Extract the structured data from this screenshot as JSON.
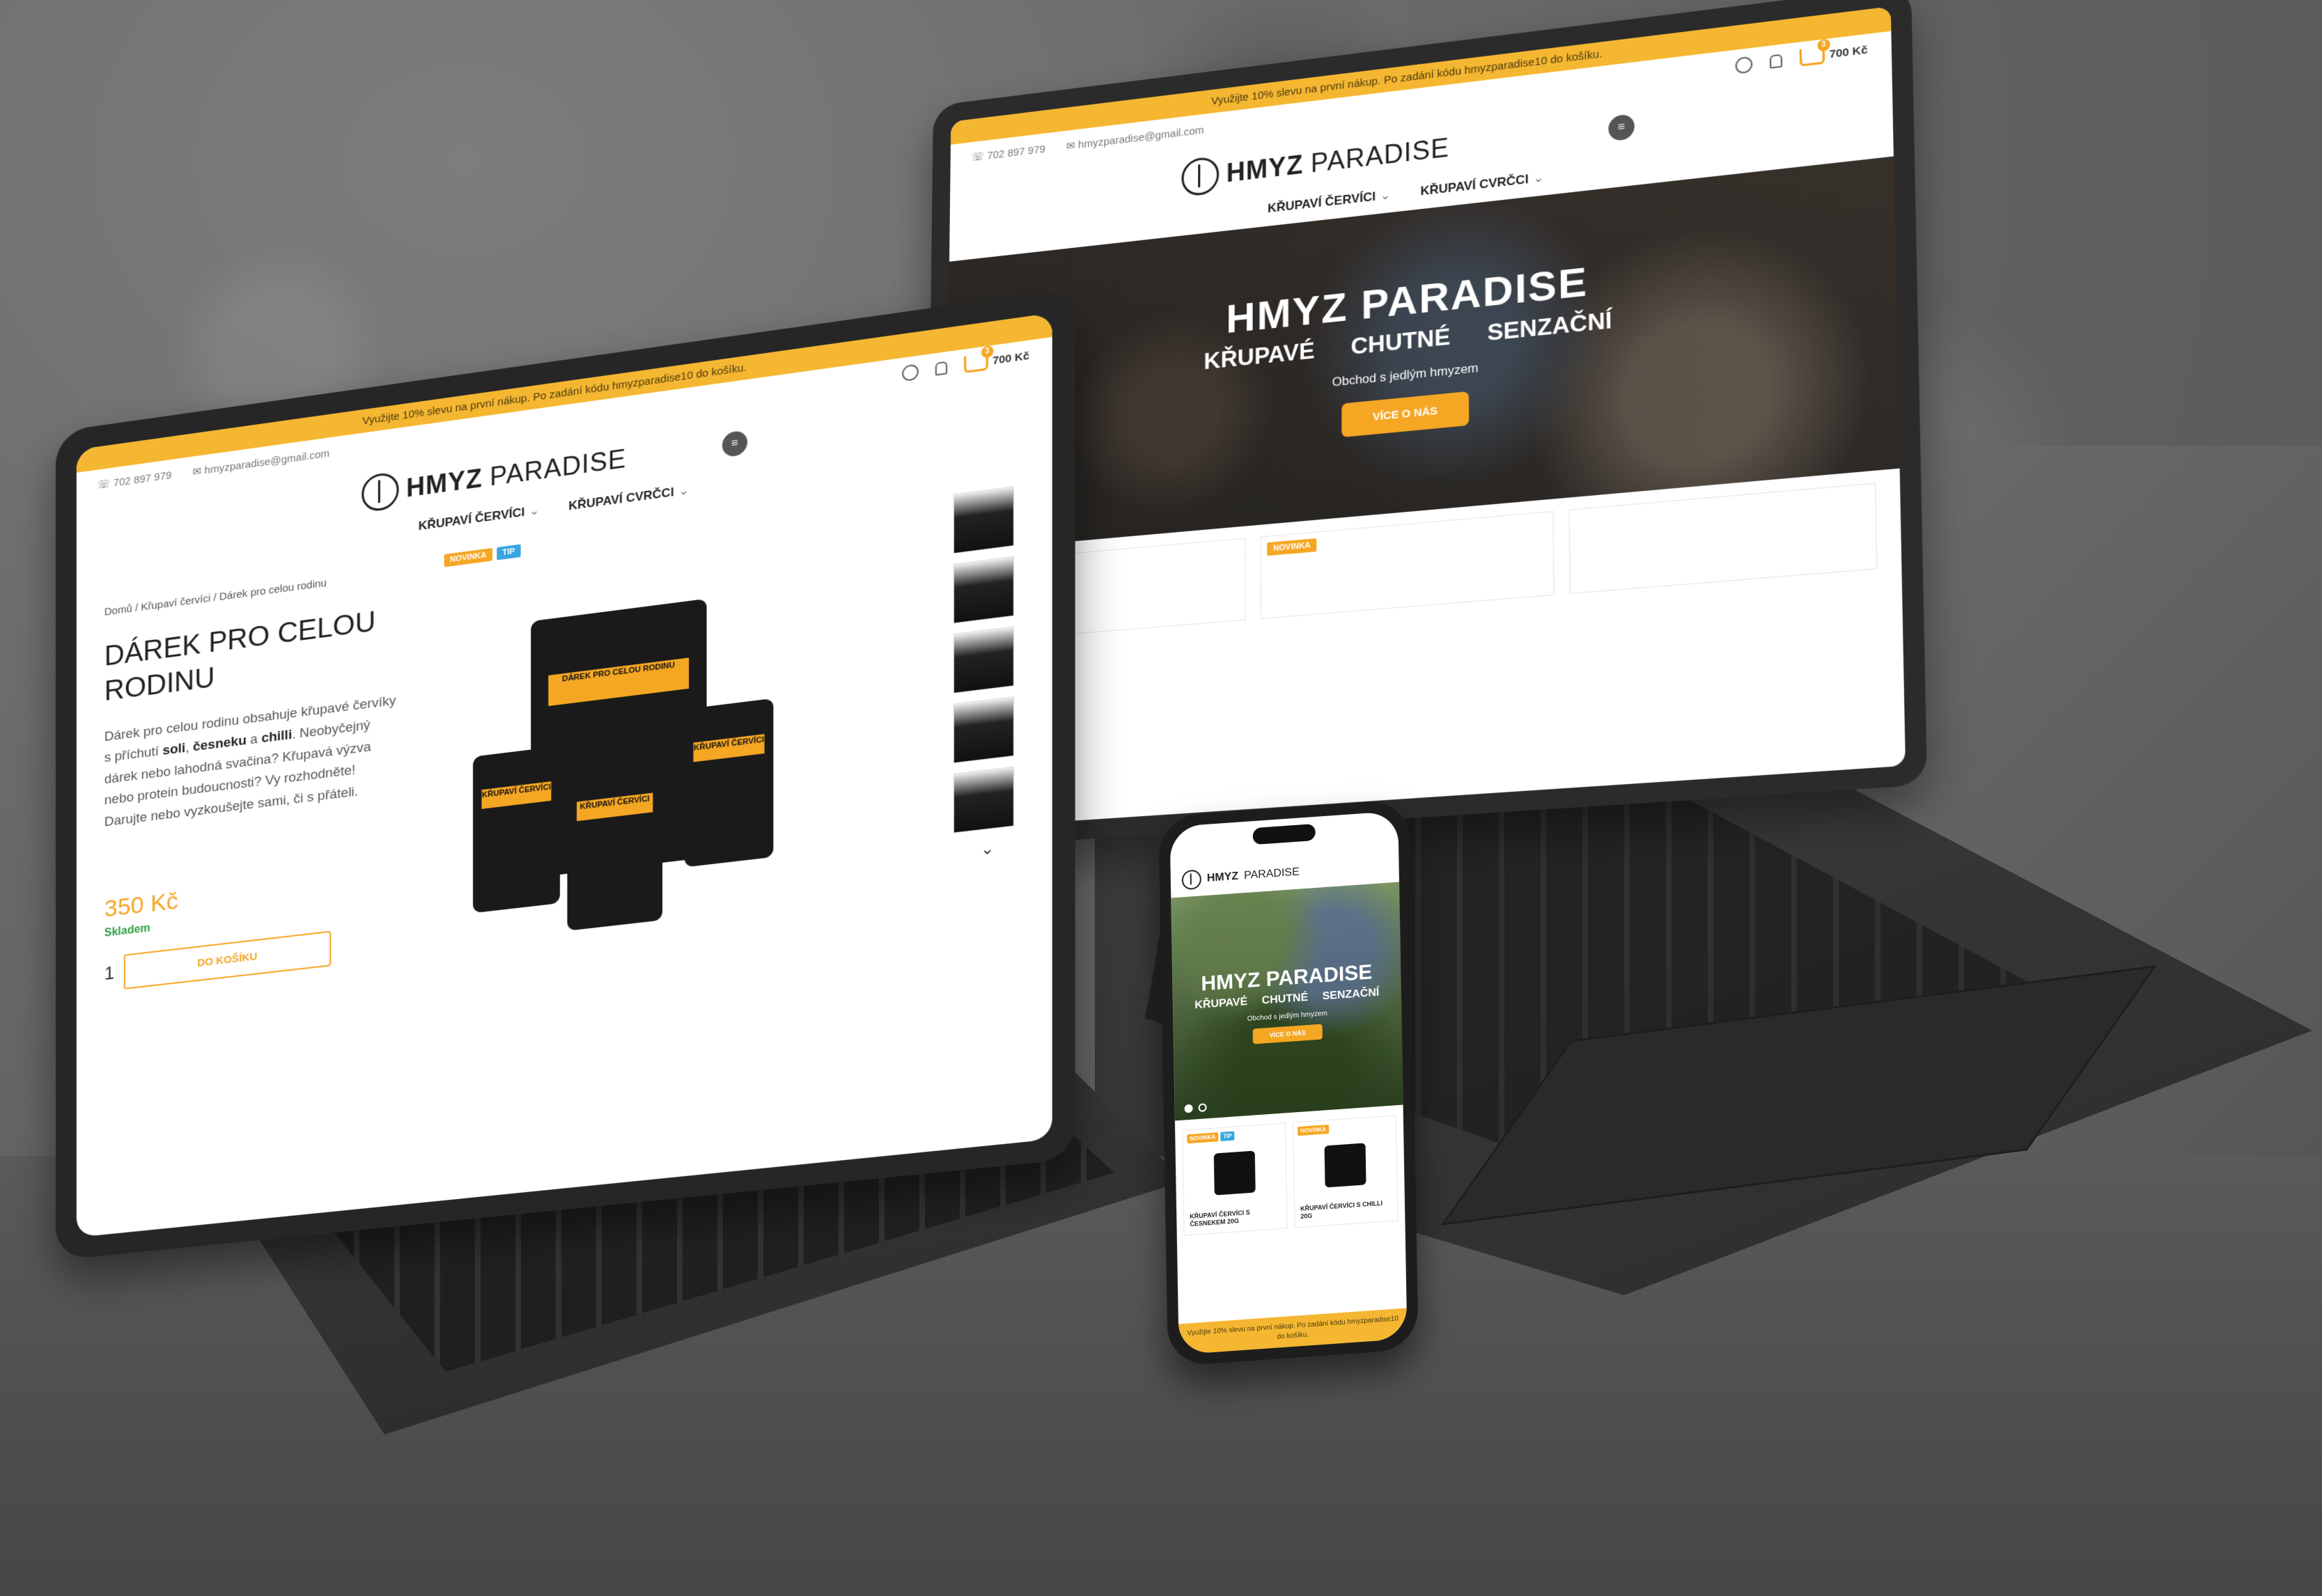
{
  "site": {
    "promo": "Využijte 10% slevu na první nákup. Po zadání kódu hmyzparadise10 do košíku.",
    "phone": "702 897 979",
    "email": "hmyzparadise@gmail.com",
    "cart_total": "700 Kč",
    "cart_count": "3",
    "logo_bold": "HMYZ",
    "logo_light": "PARADISE",
    "nav": [
      {
        "label": "KŘUPAVÍ ČERVÍCI"
      },
      {
        "label": "KŘUPAVÍ CVRČCI"
      }
    ],
    "menu_icon": "≡",
    "chevron": "⌄"
  },
  "hero": {
    "title": "HMYZ PARADISE",
    "subtitle": "KŘUPAVÉ CHUTNÉ SENZAČNÍ",
    "description": "Obchod s jedlým hmyzem",
    "button": "VÍCE O NÁS"
  },
  "badges": {
    "new": "NOVINKA",
    "tip": "TIP"
  },
  "product_page": {
    "breadcrumb": "Domů / Křupaví červíci / Dárek pro celou rodinu",
    "title": "DÁREK PRO CELOU RODINU",
    "desc_1": "Dárek pro celou rodinu obsahuje křupavé červíky s příchutí ",
    "desc_salt": "soli",
    "desc_2": ", ",
    "desc_garlic": "česneku",
    "desc_3": " a ",
    "desc_chili": "chilli",
    "desc_4": ". Neobyčejný dárek nebo lahodná svačina? Křupavá výzva nebo protein budoucnosti? Vy rozhodněte! Darujte nebo vyzkoušejte sami, či s přáteli.",
    "price": "350 Kč",
    "stock": "Skladem",
    "qty": "1",
    "add_to_cart": "DO KOŠÍKU",
    "bag_label": "DÁREK PRO CELOU RODINU",
    "pouch_label": "KŘUPAVÍ ČERVÍCI",
    "thumb_chevron": "⌄"
  },
  "phone_products": [
    {
      "name": "KŘUPAVÍ ČERVÍCI S ČESNEKEM 20G"
    },
    {
      "name": "KŘUPAVÍ ČERVÍCI S CHILLI 20G"
    }
  ]
}
